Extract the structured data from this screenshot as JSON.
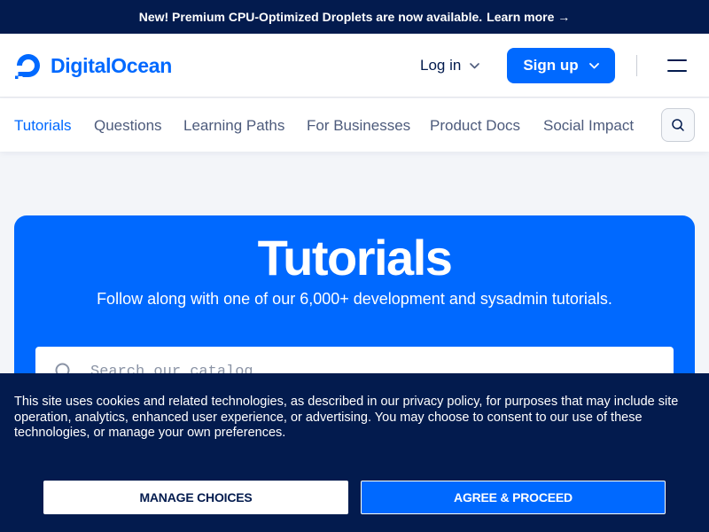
{
  "banner": {
    "text": "New! Premium CPU-Optimized Droplets are now available.",
    "link": "Learn more →"
  },
  "header": {
    "logo_text": "DigitalOcean",
    "login_label": "Log in",
    "signup_label": "Sign up",
    "brand_color": "#0069ff",
    "navy_color": "#031b4e"
  },
  "subnav": {
    "items": [
      {
        "label": "Tutorials",
        "active": true
      },
      {
        "label": "Questions"
      },
      {
        "label": "Learning Paths"
      },
      {
        "label": "For Businesses"
      },
      {
        "label": "Product Docs"
      },
      {
        "label": "Social Impact"
      }
    ]
  },
  "hero": {
    "title": "Tutorials",
    "subtitle": "Follow along with one of our 6,000+ development and sysadmin tutorials.",
    "search_placeholder": "Search our catalog"
  },
  "cookie": {
    "text": "This site uses cookies and related technologies, as described in our privacy policy, for purposes that may include site operation, analytics, enhanced user experience, or advertising. You may choose to consent to our use of these technologies, or manage your own preferences.",
    "manage_label": "MANAGE CHOICES",
    "agree_label": "AGREE & PROCEED"
  }
}
